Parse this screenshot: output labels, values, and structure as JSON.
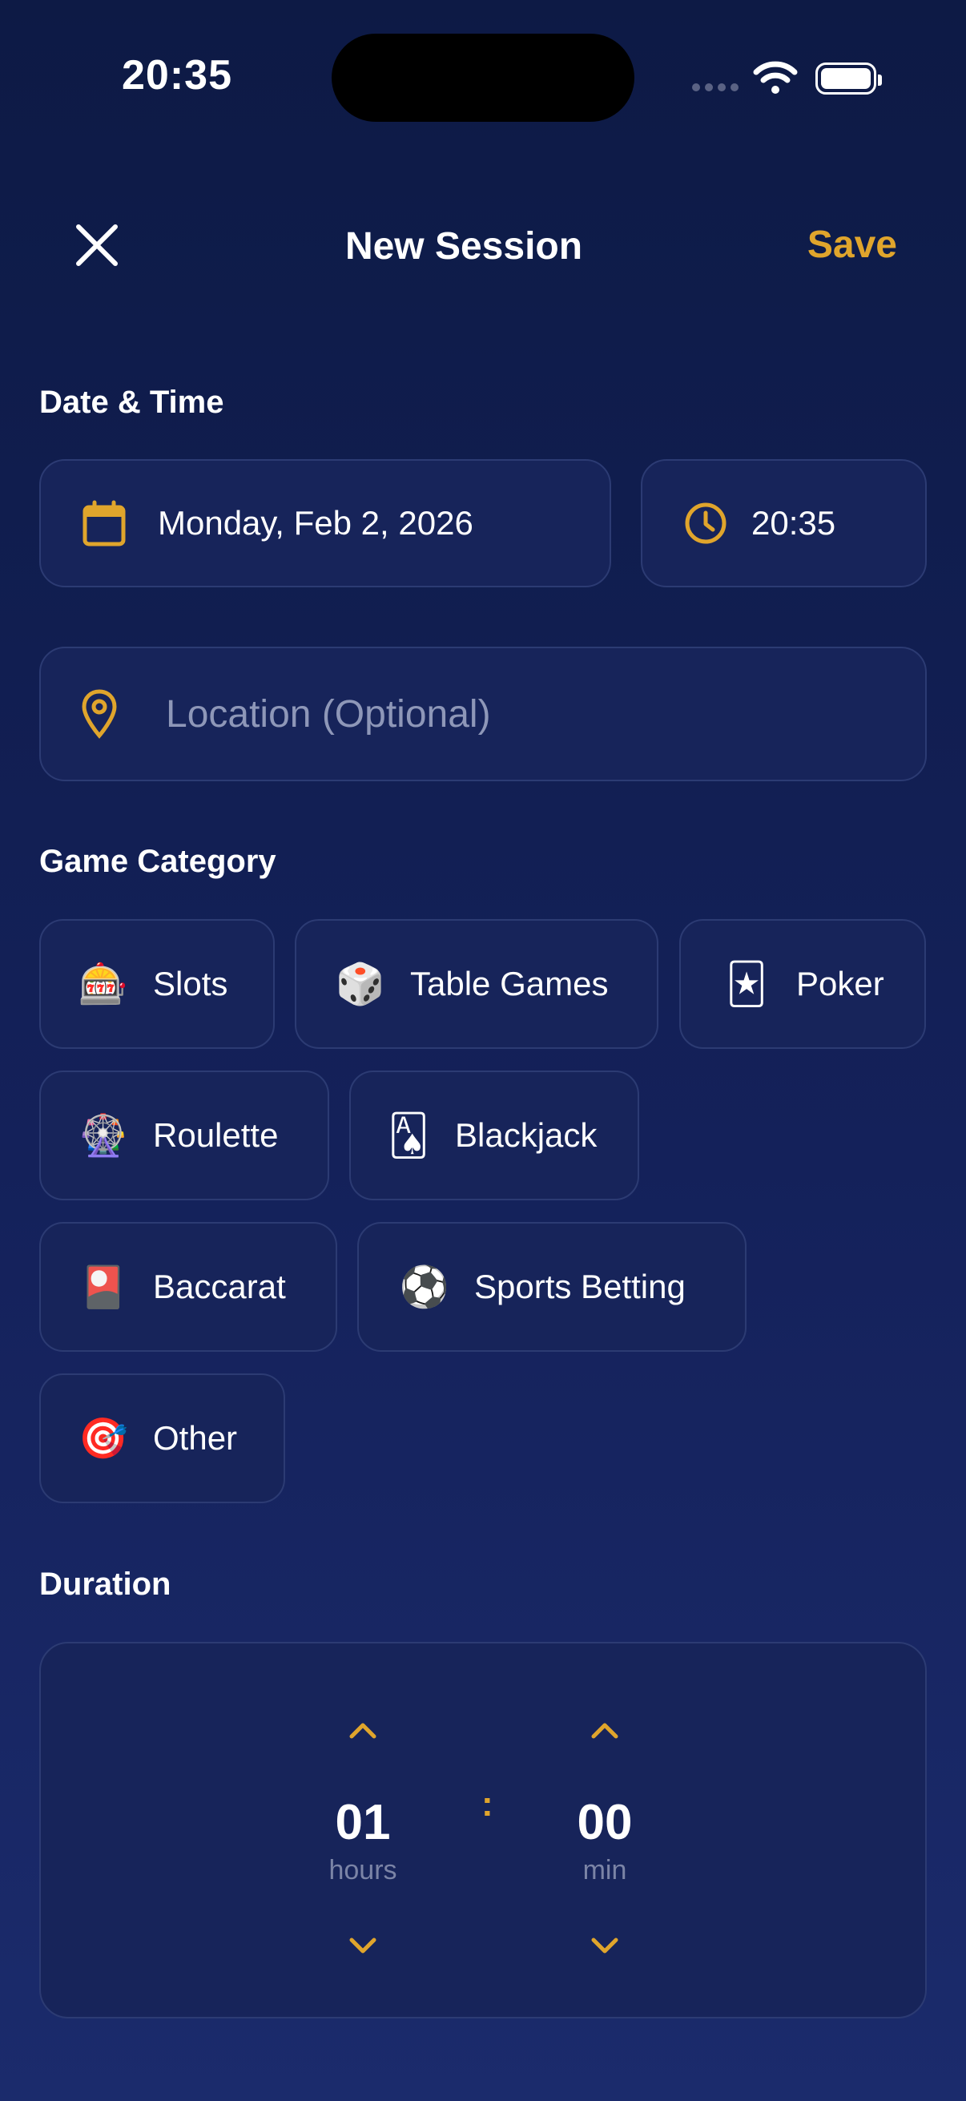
{
  "status_bar": {
    "time": "20:35"
  },
  "header": {
    "title": "New Session",
    "save_label": "Save"
  },
  "date_time": {
    "section_label": "Date & Time",
    "date_value": "Monday, Feb 2, 2026",
    "time_value": "20:35"
  },
  "location": {
    "placeholder": "Location (Optional)"
  },
  "game_category": {
    "section_label": "Game Category",
    "items": [
      {
        "emoji": "🎰",
        "label": "Slots"
      },
      {
        "emoji": "🎲",
        "label": "Table Games"
      },
      {
        "emoji": "🃏",
        "label": "Poker"
      },
      {
        "emoji": "🎡",
        "label": "Roulette"
      },
      {
        "emoji": "🂡",
        "label": "Blackjack"
      },
      {
        "emoji": "🎴",
        "label": "Baccarat"
      },
      {
        "emoji": "⚽",
        "label": "Sports Betting"
      },
      {
        "emoji": "🎯",
        "label": "Other"
      }
    ]
  },
  "duration": {
    "section_label": "Duration",
    "hours_value": "01",
    "hours_unit": "hours",
    "minutes_value": "00",
    "minutes_unit": "min",
    "separator": ":"
  },
  "colors": {
    "accent": "#e0a52c",
    "card": "#17245a",
    "border": "#2c3b73"
  },
  "icons": [
    "close-icon",
    "calendar-icon",
    "clock-icon",
    "location-pin-icon",
    "chevron-up-icon",
    "chevron-down-icon",
    "wifi-icon",
    "battery-icon"
  ]
}
